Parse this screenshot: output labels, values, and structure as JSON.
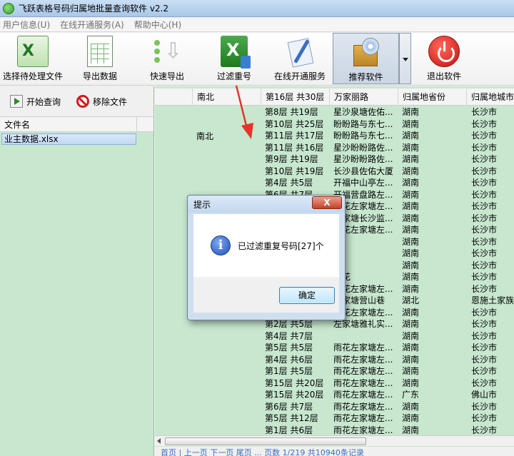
{
  "window": {
    "title": "飞跃表格号码归属地批量查询软件 v2.2"
  },
  "menu": [
    "用户信息(U)",
    "在线开通服务(A)",
    "帮助中心(H)"
  ],
  "toolbar": [
    {
      "name": "select-file-button",
      "icon": "excel-icon",
      "label": "选择待处理文件"
    },
    {
      "name": "export-data-button",
      "icon": "spreadsheet-icon",
      "label": "导出数据"
    },
    {
      "name": "quick-export-button",
      "icon": "quick-export-icon",
      "label": "快速导出"
    },
    {
      "name": "filter-duplicates-button",
      "icon": "excel-filter-icon",
      "label": "过滤重号"
    },
    {
      "name": "online-service-button",
      "icon": "edit-document-icon",
      "label": "在线开通服务"
    },
    {
      "name": "recommend-software-button",
      "icon": "software-box-icon",
      "label": "推荐软件"
    },
    {
      "name": "exit-software-button",
      "icon": "power-icon",
      "label": "退出软件"
    }
  ],
  "left_panel": {
    "start_query": "开始查询",
    "remove_file": "移除文件",
    "column_header": "文件名",
    "files": [
      "业主数据.xlsx"
    ]
  },
  "grid": {
    "headers": [
      "南北",
      "第16层 共30层",
      "万家丽路",
      "归属地省份",
      "归属地城市"
    ],
    "rows": [
      [
        "第8层 共19层",
        "星沙泉塘佐佑...",
        "湖南",
        "长沙市"
      ],
      [
        "第10层 共25层",
        "盼盼路与东七...",
        "湖南",
        "长沙市"
      ],
      [
        "第11层 共17层",
        "盼盼路与东七...",
        "湖南",
        "长沙市"
      ],
      [
        "第11层 共16层",
        "星沙盼盼路佐...",
        "湖南",
        "长沙市"
      ],
      [
        "第9层 共19层",
        "星沙盼盼路佐...",
        "湖南",
        "长沙市"
      ],
      [
        "第10层 共19层",
        "长沙县佐佑大厦",
        "湖南",
        "长沙市"
      ],
      [
        "第4层 共5层",
        "开福中山亭左...",
        "湖南",
        "长沙市"
      ],
      [
        "第6层 共7层",
        "开福营盘路左...",
        "湖南",
        "长沙市"
      ],
      [
        "第4层 共7层",
        "雨花左家塘左...",
        "湖南",
        "长沙市"
      ],
      [
        "第4层 共6层",
        "左家塘长沙监...",
        "湖南",
        "长沙市"
      ],
      [
        "第3层 共7层",
        "雨花左家塘左...",
        "湖南",
        "长沙市"
      ],
      [
        "",
        "",
        "湖南",
        "长沙市"
      ],
      [
        "",
        "山",
        "湖南",
        "长沙市"
      ],
      [
        "",
        "",
        "湖南",
        "长沙市"
      ],
      [
        "",
        "雨花",
        "湖南",
        "长沙市"
      ],
      [
        "",
        "雨花左家塘左...",
        "湖南",
        "长沙市"
      ],
      [
        "",
        "左家塘营山巷",
        "湖北",
        "恩施土家族苗"
      ],
      [
        "",
        "雨花左家塘左...",
        "湖南",
        "长沙市"
      ],
      [
        "第2层 共5层",
        "左家塘雅礼实...",
        "湖南",
        "长沙市"
      ],
      [
        "第4层 共7层",
        "",
        "湖南",
        "长沙市"
      ],
      [
        "第5层 共5层",
        "雨花左家塘左...",
        "湖南",
        "长沙市"
      ],
      [
        "第4层 共6层",
        "雨花左家塘左...",
        "湖南",
        "长沙市"
      ],
      [
        "第1层 共5层",
        "雨花左家塘左...",
        "湖南",
        "长沙市"
      ],
      [
        "第15层 共20层",
        "雨花左家塘左...",
        "湖南",
        "长沙市"
      ],
      [
        "第15层 共20层",
        "雨花左家塘左...",
        "广东",
        "佛山市"
      ],
      [
        "第6层 共7层",
        "雨花左家塘左...",
        "湖南",
        "长沙市"
      ],
      [
        "第5层 共12层",
        "雨花左家塘左...",
        "湖南",
        "长沙市"
      ],
      [
        "第1层 共6层",
        "雨花左家塘左...",
        "湖南",
        "长沙市"
      ]
    ],
    "south_north_cell": "南北",
    "pager": "首页 | 上一页 下一页 尾页 ... 页数 1/219 共10940条记录"
  },
  "dialog": {
    "title": "提示",
    "close": "X",
    "message": "已过滤重复号码[27]个",
    "ok": "确定",
    "icon": "info-icon"
  },
  "colors": {
    "grid_background": "#c7e7cf",
    "title_gradient": "#a9c7e8",
    "annotation_arrow": "#e8322a"
  }
}
